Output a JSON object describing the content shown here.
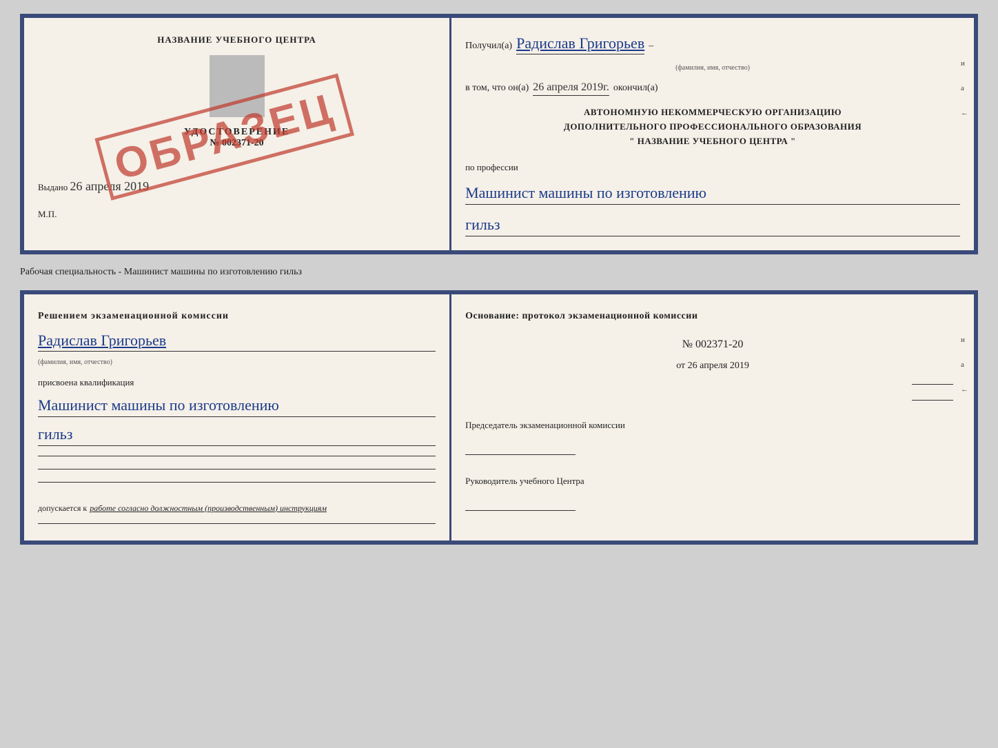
{
  "topDoc": {
    "left": {
      "centerTitle": "НАЗВАНИЕ УЧЕБНОГО ЦЕНТРА",
      "udostLabel": "УДОСТОВЕРЕНИЕ",
      "udostNumber": "№ 002371-20",
      "vydano": "Выдано",
      "vydanoDate": "26 апреля 2019",
      "mpLabel": "М.П.",
      "obrazets": "ОБРАЗЕЦ"
    },
    "right": {
      "poluchilLabel": "Получил(а)",
      "recipientName": "Радислав Григорьев",
      "familyLabel": "(фамилия, имя, отчество)",
      "vtomLabel": "в том, что он(а)",
      "completedDate": "26 апреля 2019г.",
      "okonchilLabel": "окончил(а)",
      "orgLine1": "АВТОНОМНУЮ НЕКОММЕРЧЕСКУЮ ОРГАНИЗАЦИЮ",
      "orgLine2": "ДОПОЛНИТЕЛЬНОГО ПРОФЕССИОНАЛЬНОГО ОБРАЗОВАНИЯ",
      "orgLine3": "\"  НАЗВАНИЕ УЧЕБНОГО ЦЕНТРА  \"",
      "poProfessiiLabel": "по профессии",
      "professionLine1": "Машинист машины по изготовлению",
      "professionLine2": "гильз",
      "edgeMark1": "и",
      "edgeMark2": "а",
      "edgeMark3": "←"
    }
  },
  "separatorLabel": "Рабочая специальность - Машинист машины по изготовлению гильз",
  "bottomDoc": {
    "left": {
      "resheniyemLabel": "Решением  экзаменационной  комиссии",
      "recipientName": "Радислав Григорьев",
      "familyLabel": "(фамилия, имя, отчество)",
      "prisvoenaLabel": "присвоена квалификация",
      "professionLine1": "Машинист машины по изготовлению",
      "professionLine2": "гильз",
      "dopuskaetsya": "допускается к",
      "workText": "работе согласно должностным (производственным) инструкциям"
    },
    "right": {
      "osnovaniyeLabel": "Основание: протокол экзаменационной  комиссии",
      "protocolNumber": "№  002371-20",
      "otLabel": "от",
      "protocolDate": "26 апреля 2019",
      "predsedatelLabel": "Председатель экзаменационной комиссии",
      "rukovoditelLabel": "Руководитель учебного Центра",
      "edgeMark1": "и",
      "edgeMark2": "а",
      "edgeMark3": "←"
    }
  }
}
